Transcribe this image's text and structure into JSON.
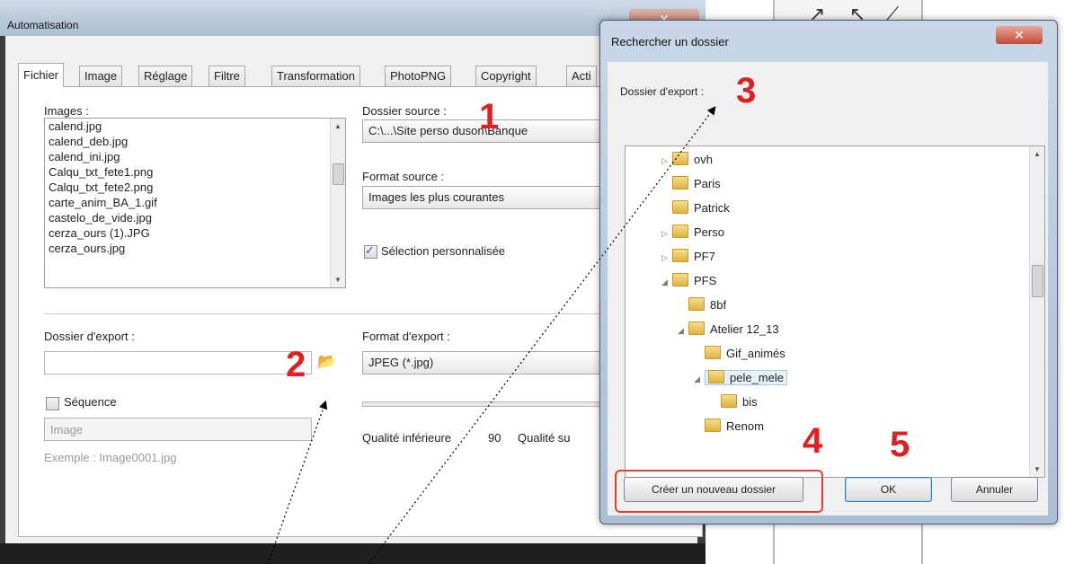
{
  "main": {
    "title": "Automatisation",
    "close_glyph": "✕",
    "tabs": [
      "Fichier",
      "Image",
      "Réglage",
      "Filtre",
      "Transformation",
      "PhotoPNG",
      "Copyright",
      "Acti"
    ],
    "images_label": "Images :",
    "images": [
      "calend.jpg",
      "calend_deb.jpg",
      "calend_ini.jpg",
      "Calqu_txt_fete1.png",
      "Calqu_txt_fete2.png",
      "carte_anim_BA_1.gif",
      "castelo_de_vide.jpg",
      "cerza_ours (1).JPG",
      "cerza_ours.jpg"
    ],
    "source_folder_label": "Dossier source :",
    "source_folder_value": "C:\\...\\Site perso duson\\Banque",
    "source_format_label": "Format source :",
    "source_format_value": "Images les plus courantes",
    "custom_selection_label": "Sélection personnalisée",
    "custom_selection_checked": true,
    "export_folder_label": "Dossier d'export :",
    "export_folder_value": "",
    "export_format_label": "Format d'export :",
    "export_format_value": "JPEG (*.jpg)",
    "sequence_label": "Séquence",
    "sequence_checked": false,
    "sequence_name_value": "Image",
    "example_text": "Exemple : Image0001.jpg",
    "quality_low_label": "Qualité inférieure",
    "quality_value": "90",
    "quality_high_label": "Qualité su"
  },
  "dialog": {
    "title": "Rechercher un dossier",
    "close_glyph": "✕",
    "export_label": "Dossier d'export :",
    "tree": [
      {
        "name": "ovh",
        "expander": "▷"
      },
      {
        "name": "Paris",
        "expander": ""
      },
      {
        "name": "Patrick",
        "expander": ""
      },
      {
        "name": "Perso",
        "expander": "▷"
      },
      {
        "name": "PF7",
        "expander": "▷"
      },
      {
        "name": "PFS",
        "expander": "◢"
      },
      {
        "name": "8bf",
        "expander": ""
      },
      {
        "name": "Atelier 12_13",
        "expander": "◢"
      },
      {
        "name": "Gif_animés",
        "expander": ""
      },
      {
        "name": "pele_mele",
        "expander": "◢"
      },
      {
        "name": "bis",
        "expander": ""
      },
      {
        "name": "Renom",
        "expander": ""
      }
    ],
    "new_folder_button": "Créer un nouveau dossier",
    "ok_button": "OK",
    "cancel_button": "Annuler"
  },
  "annotations": [
    "1",
    "2",
    "3",
    "4",
    "5"
  ],
  "colors": {
    "annotation": "#e02020",
    "selection": "#e5f1fb"
  }
}
